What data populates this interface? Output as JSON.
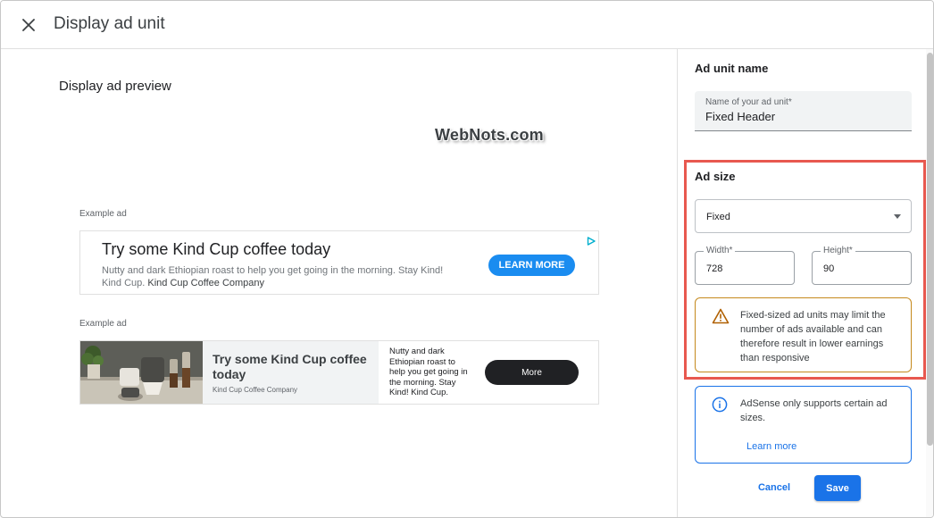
{
  "header": {
    "title": "Display ad unit",
    "close_icon": "close-icon"
  },
  "preview": {
    "title": "Display ad preview",
    "watermark": "WebNots.com",
    "ads": [
      {
        "label": "Example ad",
        "headline": "Try some Kind Cup coffee today",
        "description": "Nutty and dark Ethiopian roast to help you get going in the morning. Stay Kind! Kind Cup.",
        "company": "Kind Cup Coffee Company",
        "cta": "LEARN MORE",
        "cta_color": "#1a8cf0",
        "adchoices_icon": "adchoices-icon"
      },
      {
        "label": "Example ad",
        "headline": "Try some Kind Cup coffee today",
        "company": "Kind Cup Coffee Company",
        "description": "Nutty and dark Ethiopian roast to help you get going in the morning. Stay Kind! Kind Cup.",
        "cta": "More",
        "image_icon": "coffee-product-image"
      }
    ]
  },
  "panel": {
    "name_section": {
      "title": "Ad unit name",
      "field_label": "Name of your ad unit*",
      "field_value": "Fixed Header"
    },
    "size_section": {
      "title": "Ad size",
      "highlight_color": "#e8584f",
      "select_value": "Fixed",
      "width_label": "Width*",
      "width_value": "728",
      "height_label": "Height*",
      "height_value": "90",
      "warning_icon": "warning-icon",
      "warning_text": "Fixed-sized ad units may limit the number of ads available and can therefore result in lower earnings than responsive"
    },
    "info": {
      "icon": "info-icon",
      "text": "AdSense only supports certain ad sizes.",
      "link": "Learn more"
    },
    "actions": {
      "cancel": "Cancel",
      "save": "Save",
      "primary_color": "#1a73e8"
    }
  }
}
